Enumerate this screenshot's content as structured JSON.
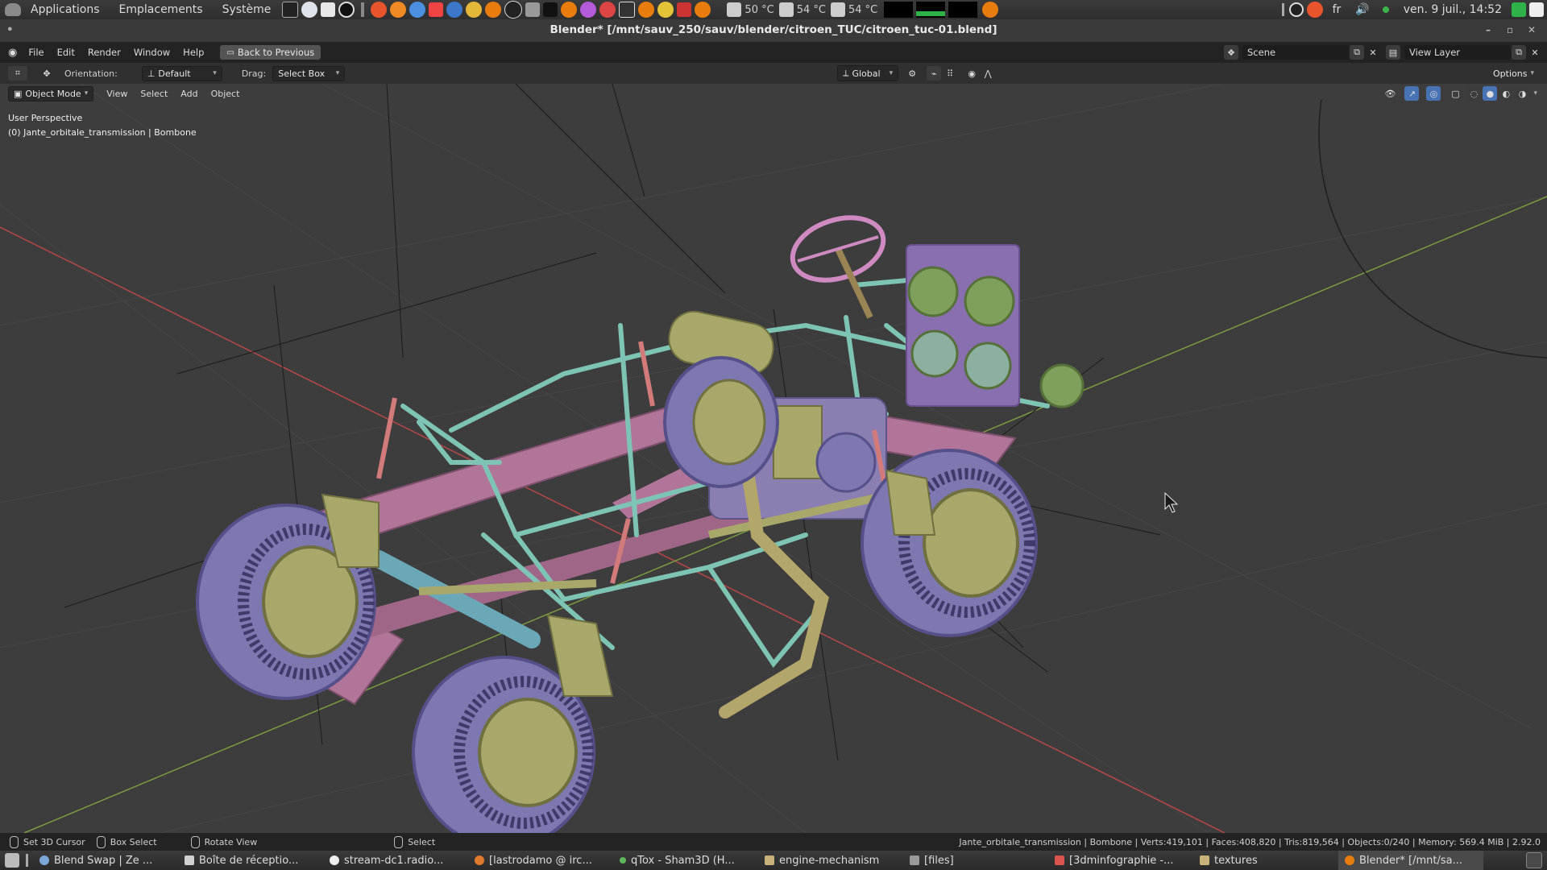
{
  "desktop_panel": {
    "menus": [
      "Applications",
      "Emplacements",
      "Système"
    ],
    "temps": [
      "50 °C",
      "54 °C",
      "54 °C"
    ],
    "keyboard_layout": "fr",
    "clock": "ven. 9 juil., 14:52"
  },
  "window": {
    "title": "Blender* [/mnt/sauv_250/sauv/blender/citroen_TUC/citroen_tuc-01.blend]"
  },
  "blender_topbar": {
    "menus": [
      "File",
      "Edit",
      "Render",
      "Window",
      "Help"
    ],
    "back_button": "Back to Previous",
    "scene": "Scene",
    "view_layer": "View Layer"
  },
  "tool_header": {
    "orientation_label": "Orientation:",
    "orientation_value": "Default",
    "drag_label": "Drag:",
    "drag_value": "Select Box",
    "transform_orientation": "Global",
    "options": "Options"
  },
  "viewport_header": {
    "mode": "Object Mode",
    "menus": [
      "View",
      "Select",
      "Add",
      "Object"
    ]
  },
  "viewport": {
    "perspective": "User Perspective",
    "active_object": "(0) Jante_orbitale_transmission | Bombone"
  },
  "status_bar": {
    "hints": [
      "Set 3D Cursor",
      "Box Select",
      "Rotate View",
      "Select"
    ],
    "stats": "Jante_orbitale_transmission | Bombone | Verts:419,101 | Faces:408,820 | Tris:819,564 | Objects:0/240 | Memory: 569.4 MiB | 2.92.0"
  },
  "taskbar": {
    "tasks": [
      {
        "label": "Blend Swap | Ze ...",
        "color": "#7aa7d8"
      },
      {
        "label": "Boîte de réceptio...",
        "color": "#d0d0d0"
      },
      {
        "label": "stream-dc1.radio...",
        "color": "#eeeeee"
      },
      {
        "label": "[lastrodamo @ irc...",
        "color": "#e07a2c"
      },
      {
        "label": "qTox - Sham3D (H...",
        "color": "#5cb85c"
      },
      {
        "label": "engine-mechanism",
        "color": "#c9b27a"
      },
      {
        "label": "[files]",
        "color": "#9a9a9a"
      },
      {
        "label": "[3dminfographie -...",
        "color": "#d9534f"
      },
      {
        "label": "textures",
        "color": "#c9b27a"
      },
      {
        "label": "Blender* [/mnt/sa...",
        "color": "#e87d0d"
      }
    ]
  },
  "colors": {
    "chassis": "#b07598",
    "tube_frame": "#7ec4b4",
    "tire": "#7d78b0",
    "rim": "#a8a86a",
    "axis_x": "#c44a4a",
    "axis_y": "#7da040",
    "grid": "#464646"
  }
}
